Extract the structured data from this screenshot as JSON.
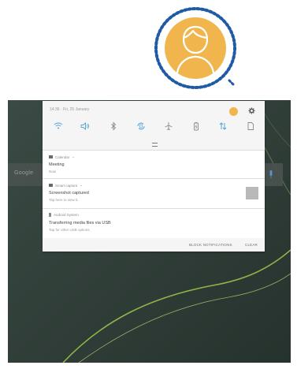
{
  "callout": {
    "icon": "user-avatar-icon",
    "color": "#f0b64d",
    "border_color": "#1f5aa6"
  },
  "status_bar": {
    "time_date": "14:36 · Fri, 25 January",
    "avatar_icon": "user-avatar-icon",
    "settings_icon": "gear-icon"
  },
  "quick_settings": [
    {
      "icon": "wifi-icon",
      "active": true
    },
    {
      "icon": "sound-icon",
      "active": true
    },
    {
      "icon": "bluetooth-icon",
      "active": false
    },
    {
      "icon": "auto-rotate-icon",
      "active": true
    },
    {
      "icon": "airplane-icon",
      "active": false
    },
    {
      "icon": "power-saving-icon",
      "active": false
    },
    {
      "icon": "mobile-data-icon",
      "active": true
    },
    {
      "icon": "document-icon",
      "active": false
    }
  ],
  "notifications": [
    {
      "app": "Calendar",
      "title": "Meeting",
      "body": "Now"
    },
    {
      "app": "Smart capture",
      "title": "Screenshot captured",
      "body": "Tap here to view it."
    },
    {
      "app": "Android System",
      "title": "Transferring media files via USB",
      "body": "Tap for other USB options."
    }
  ],
  "footer": {
    "block_label": "BLOCK NOTIFICATIONS",
    "clear_label": "CLEAR"
  },
  "search": {
    "label": "Google"
  },
  "colors": {
    "accent": "#4fa3d9",
    "wallpaper": "#2e3b35",
    "panel": "#f5f5f5"
  }
}
